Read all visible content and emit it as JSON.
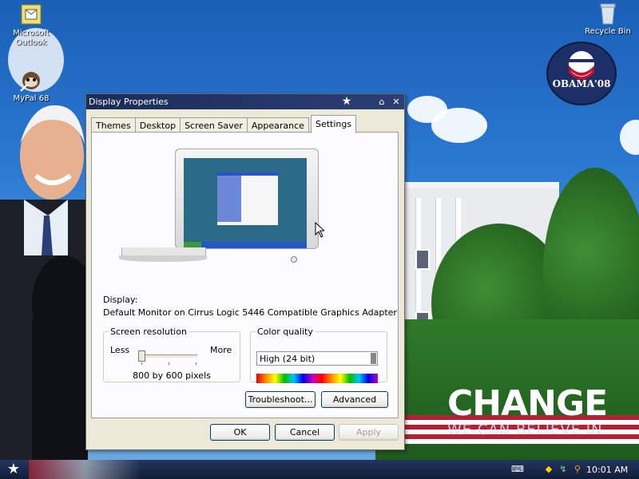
{
  "desktop": {
    "icons": [
      {
        "label": "Microsoft\nOutlook",
        "line1": "Microsoft",
        "line2": "Outlook",
        "icon": "outlook-icon"
      },
      {
        "label": "MyPal 68",
        "icon": "mypal-icon"
      },
      {
        "label": "Recycle Bin",
        "icon": "recycle-bin-icon"
      }
    ],
    "logo": {
      "text": "OBAMA'08"
    },
    "wallpaper": {
      "headline": "CHANGE",
      "tagline": "WE CAN BELIEVE IN"
    }
  },
  "dialog": {
    "title": "Display Properties",
    "tabs": [
      "Themes",
      "Desktop",
      "Screen Saver",
      "Appearance",
      "Settings"
    ],
    "active_tab": "Settings",
    "display_label": "Display:",
    "display_value": "Default Monitor on Cirrus Logic 5446 Compatible Graphics Adapter",
    "resolution": {
      "group_label": "Screen resolution",
      "less": "Less",
      "more": "More",
      "value": "800 by 600 pixels",
      "slider_position": 0
    },
    "color": {
      "group_label": "Color quality",
      "selected": "High (24 bit)"
    },
    "buttons": {
      "troubleshoot": "Troubleshoot...",
      "advanced": "Advanced",
      "ok": "OK",
      "cancel": "Cancel",
      "apply": "Apply"
    }
  },
  "taskbar": {
    "clock": "10:01 AM"
  },
  "colors": {
    "titlebar": "#1a2c58",
    "taskbar": "#1b2a4e",
    "dialog_bg": "#ece9d8"
  }
}
